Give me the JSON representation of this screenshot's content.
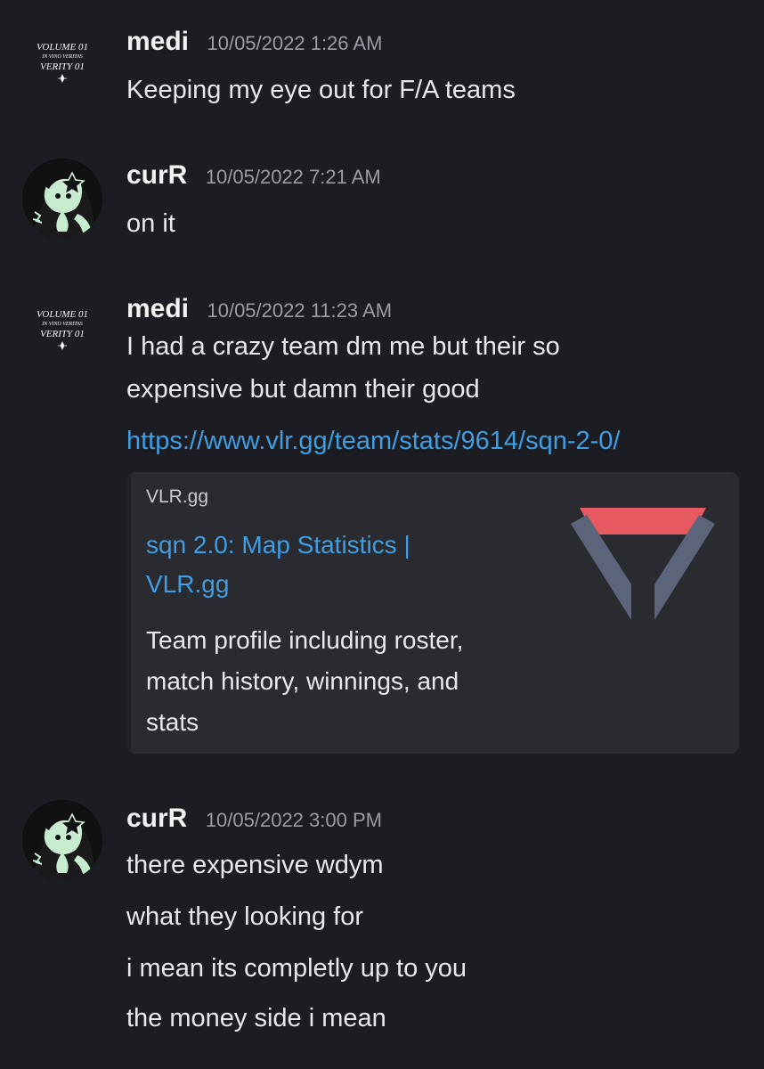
{
  "messages": [
    {
      "author": "medi",
      "timestamp": "10/05/2022 1:26 AM",
      "avatar_text": [
        "VOLUME 01",
        "IN VINO VERITAS",
        "VERITY 01"
      ],
      "lines": [
        "Keeping my eye out for F/A teams"
      ]
    },
    {
      "author": "curR",
      "timestamp": "10/05/2022 7:21 AM",
      "lines": [
        "on it"
      ]
    },
    {
      "author": "medi",
      "timestamp": "10/05/2022 11:23 AM",
      "avatar_text": [
        "VOLUME 01",
        "IN VINO VERITAS",
        "VERITY 01"
      ],
      "lines": [
        "I had a crazy team dm me but their so",
        "expensive but damn their good"
      ],
      "link": "https://www.vlr.gg/team/stats/9614/sqn-2-0/",
      "embed": {
        "provider": "VLR.gg",
        "title_lines": [
          "sqn 2.0: Map Statistics |",
          "VLR.gg"
        ],
        "description_lines": [
          "Team profile including roster,",
          "match history, winnings, and",
          "stats"
        ]
      }
    },
    {
      "author": "curR",
      "timestamp": "10/05/2022 3:00 PM",
      "lines": [
        "there expensive wdym",
        "what they looking for",
        "i mean its completly up to you",
        "the money side i mean"
      ]
    }
  ],
  "colors": {
    "background": "#1c1d22",
    "link": "#3f9de2",
    "embed_bg": "#2a2b31",
    "logo_red": "#e85a62",
    "logo_slate": "#5b6478"
  }
}
